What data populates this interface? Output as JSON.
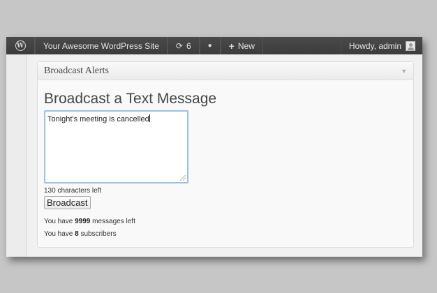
{
  "adminbar": {
    "site_name": "Your Awesome WordPress Site",
    "updates_count": "6",
    "new_label": "New",
    "howdy": "Howdy, admin",
    "logo_glyph": "W",
    "updates_icon": "refresh-icon",
    "comments_icon": "speech-bubble-icon",
    "new_icon": "plus-icon",
    "update_glyph": "⟳",
    "comment_glyph": "●",
    "plus_glyph": "+"
  },
  "panel": {
    "title": "Broadcast Alerts",
    "toggle_glyph": "▼"
  },
  "form": {
    "heading": "Broadcast a Text Message",
    "message_value": "Tonight's meeting is cancelled",
    "chars_left": "130 characters left",
    "button_label": "Broadcast"
  },
  "stats": {
    "prefix": "You have",
    "messages_count": "9999",
    "messages_suffix": "messages left",
    "subscribers_count": "8",
    "subscribers_suffix": "subscribers"
  },
  "colors": {
    "adminbar_bg": "#464646",
    "focus_border": "#9cc0e6"
  }
}
